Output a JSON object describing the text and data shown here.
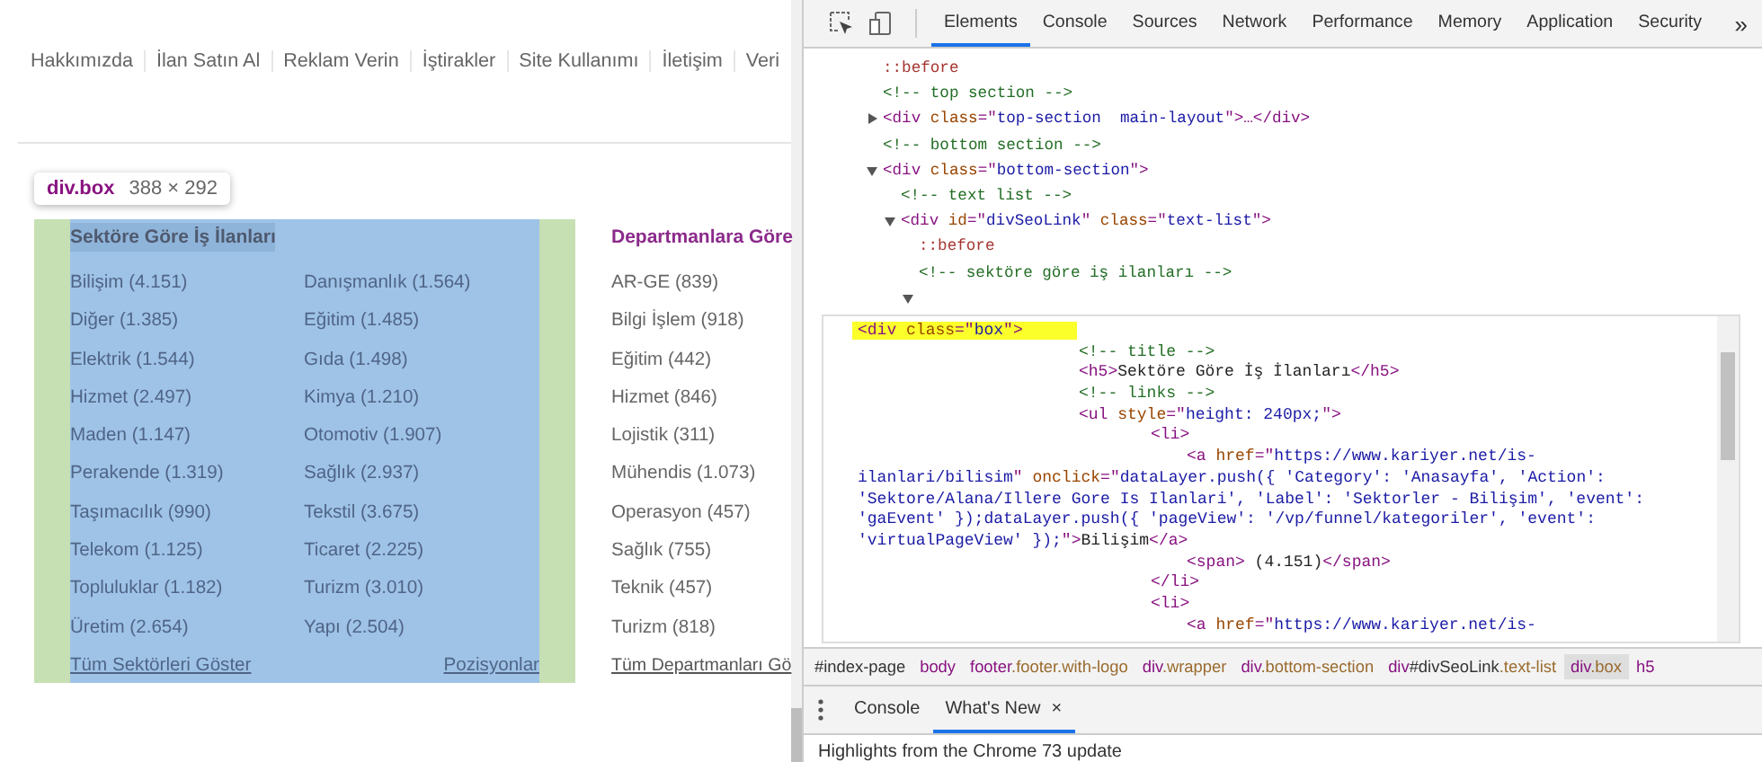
{
  "page": {
    "nav": [
      "Hakkımızda",
      "İlan Satın Al",
      "Reklam Verin",
      "İştirakler",
      "Site Kullanımı",
      "İletişim",
      "Veri"
    ],
    "tooltip": {
      "selector": "div.box",
      "size": "388 × 292"
    },
    "sector_box": {
      "title": "Sektöre Göre İş İlanları",
      "columns": [
        [
          "Bilişim (4.151)",
          "Diğer (1.385)",
          "Elektrik (1.544)",
          "Hizmet (2.497)",
          "Maden (1.147)",
          "Perakende (1.319)",
          "Taşımacılık (990)",
          "Telekom (1.125)",
          "Topluluklar (1.182)",
          "Üretim (2.654)"
        ],
        [
          "Danışmanlık (1.564)",
          "Eğitim (1.485)",
          "Gıda (1.498)",
          "Kimya (1.210)",
          "Otomotiv (1.907)",
          "Sağlık (2.937)",
          "Tekstil (3.675)",
          "Ticaret (2.225)",
          "Turizm (3.010)",
          "Yapı (2.504)"
        ]
      ],
      "links": [
        "Tüm Sektörleri Göster",
        "Pozisyonlar"
      ]
    },
    "department_box": {
      "title": "Departmanlara Göre",
      "items": [
        "AR-GE (839)",
        "Bilgi İşlem (918)",
        "Eğitim (442)",
        "Hizmet (846)",
        "Lojistik (311)",
        "Mühendis (1.073)",
        "Operasyon (457)",
        "Sağlık (755)",
        "Teknik (457)",
        "Turizm (818)"
      ],
      "link": "Tüm Departmanları Gö"
    }
  },
  "devtools": {
    "tabs": [
      {
        "label": "Elements",
        "selected": true
      },
      {
        "label": "Console",
        "selected": false
      },
      {
        "label": "Sources",
        "selected": false
      },
      {
        "label": "Network",
        "selected": false
      },
      {
        "label": "Performance",
        "selected": false
      },
      {
        "label": "Memory",
        "selected": false
      },
      {
        "label": "Application",
        "selected": false
      },
      {
        "label": "Security",
        "selected": false
      }
    ],
    "more": "»",
    "tree": [
      {
        "segments": [
          {
            "kind": "pseudo",
            "text": "::before"
          }
        ]
      },
      {
        "segments": [
          {
            "kind": "comment",
            "text": "<!-- top section -->"
          }
        ]
      },
      {
        "expanded": false,
        "segments": [
          {
            "kind": "tag",
            "text": "<div "
          },
          {
            "kind": "attr",
            "text": "class"
          },
          {
            "kind": "tag",
            "text": "=\""
          },
          {
            "kind": "value",
            "text": "top-section  main-layout"
          },
          {
            "kind": "tag",
            "text": "\">…</div>"
          }
        ]
      },
      {
        "segments": [
          {
            "kind": "comment",
            "text": "<!-- bottom section -->"
          }
        ]
      },
      {
        "expanded": true,
        "segments": [
          {
            "kind": "tag",
            "text": "<div "
          },
          {
            "kind": "attr",
            "text": "class"
          },
          {
            "kind": "tag",
            "text": "=\""
          },
          {
            "kind": "value",
            "text": "bottom-section"
          },
          {
            "kind": "tag",
            "text": "\">"
          }
        ],
        "children": [
          {
            "segments": [
              {
                "kind": "comment",
                "text": "<!-- text list -->"
              }
            ]
          },
          {
            "expanded": true,
            "segments": [
              {
                "kind": "tag",
                "text": "<div "
              },
              {
                "kind": "attr",
                "text": "id"
              },
              {
                "kind": "tag",
                "text": "=\""
              },
              {
                "kind": "value",
                "text": "divSeoLink"
              },
              {
                "kind": "tag",
                "text": "\" "
              },
              {
                "kind": "attr",
                "text": "class"
              },
              {
                "kind": "tag",
                "text": "=\""
              },
              {
                "kind": "value",
                "text": "text-list"
              },
              {
                "kind": "tag",
                "text": "\">"
              }
            ],
            "children": [
              {
                "segments": [
                  {
                    "kind": "pseudo",
                    "text": "::before"
                  }
                ]
              },
              {
                "segments": [
                  {
                    "kind": "comment",
                    "text": "<!-- sektöre göre iş ilanları -->"
                  }
                ]
              },
              {
                "expanded": true
              }
            ]
          }
        ]
      }
    ],
    "editor": [
      {
        "highlighted": true,
        "segments": [
          {
            "kind": "tag",
            "text": "<div "
          },
          {
            "kind": "attr",
            "text": "class"
          },
          {
            "kind": "tag",
            "text": "=\""
          },
          {
            "kind": "value",
            "text": "box"
          },
          {
            "kind": "tag",
            "text": "\">"
          }
        ],
        "children": [
          {
            "segments": [
              {
                "kind": "comment",
                "text": "<!-- title -->"
              }
            ]
          },
          {
            "segments": [
              {
                "kind": "tag",
                "text": "<h5>"
              },
              {
                "kind": "plain",
                "text": "Sektöre Göre İş İlanları"
              },
              {
                "kind": "tag",
                "text": "</h5>"
              }
            ]
          },
          {
            "segments": [
              {
                "kind": "comment",
                "text": "<!-- links -->"
              }
            ]
          },
          {
            "segments": [
              {
                "kind": "tag",
                "text": "<ul "
              },
              {
                "kind": "attr",
                "text": "style"
              },
              {
                "kind": "tag",
                "text": "=\""
              },
              {
                "kind": "value",
                "text": "height: 240px;"
              },
              {
                "kind": "tag",
                "text": "\">"
              }
            ],
            "children": [
              {
                "segments": [
                  {
                    "kind": "tag",
                    "text": "<li>"
                  }
                ],
                "children": [
                  {
                    "segments": [
                      {
                        "kind": "tag",
                        "text": "<a "
                      },
                      {
                        "kind": "attr",
                        "text": "href"
                      },
                      {
                        "kind": "tag",
                        "text": "=\""
                      },
                      {
                        "kind": "value",
                        "text": "https://www.kariyer.net/is-ilanlari/bilisim"
                      },
                      {
                        "kind": "tag",
                        "text": "\" "
                      },
                      {
                        "kind": "attr",
                        "text": "onclick"
                      },
                      {
                        "kind": "tag",
                        "text": "=\""
                      },
                      {
                        "kind": "value",
                        "text": "dataLayer.push({ 'Category': 'Anasayfa', 'Action': 'Sektore/Alana/Illere Gore Is Ilanlari', 'Label': 'Sektorler - Bilişim', 'event': 'gaEvent' });dataLayer.push({ 'pageView': '/vp/funnel/kategoriler', 'event': 'virtualPageView' });"
                      },
                      {
                        "kind": "tag",
                        "text": "\">"
                      },
                      {
                        "kind": "plain",
                        "text": "Bilişim"
                      },
                      {
                        "kind": "tag",
                        "text": "</a>"
                      }
                    ]
                  },
                  {
                    "segments": [
                      {
                        "kind": "tag",
                        "text": "<span>"
                      },
                      {
                        "kind": "plain",
                        "text": " (4.151)"
                      },
                      {
                        "kind": "tag",
                        "text": "</span>"
                      }
                    ]
                  }
                ]
              },
              {
                "segments": [
                  {
                    "kind": "tag",
                    "text": "</li>"
                  }
                ]
              },
              {
                "segments": [
                  {
                    "kind": "tag",
                    "text": "<li>"
                  }
                ],
                "children": [
                  {
                    "segments": [
                      {
                        "kind": "tag",
                        "text": "<a "
                      },
                      {
                        "kind": "attr",
                        "text": "href"
                      },
                      {
                        "kind": "tag",
                        "text": "=\""
                      },
                      {
                        "kind": "value",
                        "text": "https://www.kariyer.net/is-"
                      }
                    ]
                  }
                ]
              }
            ]
          }
        ]
      }
    ],
    "breadcrumbs": [
      {
        "selected": false,
        "segments": [
          {
            "kind": "id",
            "text": "#index-page"
          }
        ]
      },
      {
        "selected": false,
        "segments": [
          {
            "kind": "tag",
            "text": "body"
          }
        ]
      },
      {
        "selected": false,
        "segments": [
          {
            "kind": "tag",
            "text": "footer"
          },
          {
            "kind": "cls",
            "text": ".footer.with-logo"
          }
        ]
      },
      {
        "selected": false,
        "segments": [
          {
            "kind": "tag",
            "text": "div"
          },
          {
            "kind": "cls",
            "text": ".wrapper"
          }
        ]
      },
      {
        "selected": false,
        "segments": [
          {
            "kind": "tag",
            "text": "div"
          },
          {
            "kind": "cls",
            "text": ".bottom-section"
          }
        ]
      },
      {
        "selected": false,
        "segments": [
          {
            "kind": "tag",
            "text": "div"
          },
          {
            "kind": "id",
            "text": "#divSeoLink"
          },
          {
            "kind": "cls",
            "text": ".text-list"
          }
        ]
      },
      {
        "selected": true,
        "segments": [
          {
            "kind": "tag",
            "text": "div"
          },
          {
            "kind": "cls",
            "text": ".box"
          }
        ]
      },
      {
        "selected": false,
        "segments": [
          {
            "kind": "tag",
            "text": "h5"
          }
        ]
      }
    ],
    "drawer": {
      "tabs": [
        {
          "label": "Console",
          "selected": false,
          "closable": false
        },
        {
          "label": "What's New",
          "selected": true,
          "closable": true
        }
      ],
      "close": "×",
      "content": "Highlights from the Chrome 73 update"
    }
  }
}
